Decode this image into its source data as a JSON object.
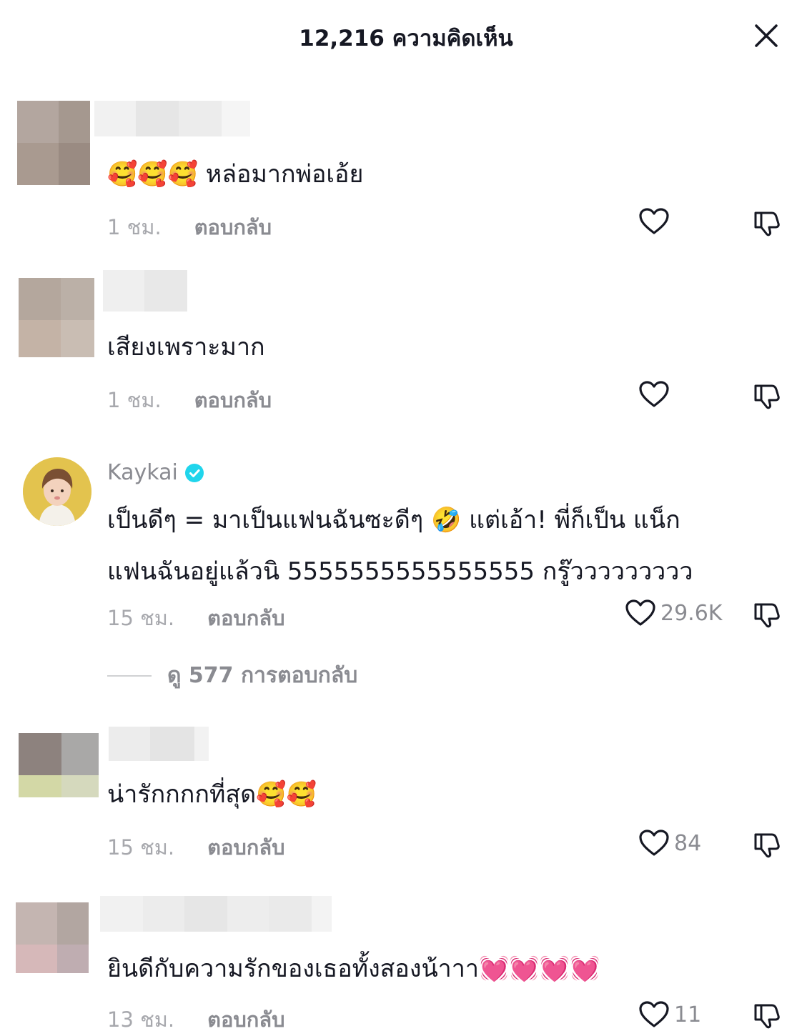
{
  "header": {
    "title": "12,216 ความคิดเห็น"
  },
  "comments": [
    {
      "text": "🥰🥰🥰 หล่อมากพ่อเอ้ย",
      "time": "1 ชม.",
      "reply_label": "ตอบกลับ",
      "likes": ""
    },
    {
      "text": "เสียงเพราะมาก",
      "time": "1 ชม.",
      "reply_label": "ตอบกลับ",
      "likes": ""
    },
    {
      "username": "Kaykai",
      "verified": true,
      "text": "เป็นดีๆ = มาเป็นแฟนฉันซะดีๆ 🤣 แต่เอ้า! พี่ก็เป็น แน็ก\nแฟนฉันอยู่แล้วนิ 5555555555555555 กรู๊ววววววววว",
      "time": "15 ชม.",
      "reply_label": "ตอบกลับ",
      "likes": "29.6K",
      "view_replies": "ดู 577 การตอบกลับ"
    },
    {
      "text": "น่ารักกกกที่สุด🥰🥰",
      "time": "15 ชม.",
      "reply_label": "ตอบกลับ",
      "likes": "84"
    },
    {
      "text": "ยินดีกับความรักของเธอทั้งสองน้าาา💓💓💓💓",
      "time": "13 ชม.",
      "reply_label": "ตอบกลับ",
      "likes": "11"
    }
  ],
  "colors": {
    "text_primary": "#161823",
    "text_secondary": "#8a8b91",
    "time": "#a7a8ad",
    "verified": "#20d5ec"
  },
  "icons": [
    "close-icon",
    "heart-icon",
    "dislike-icon",
    "verified-badge-icon"
  ]
}
